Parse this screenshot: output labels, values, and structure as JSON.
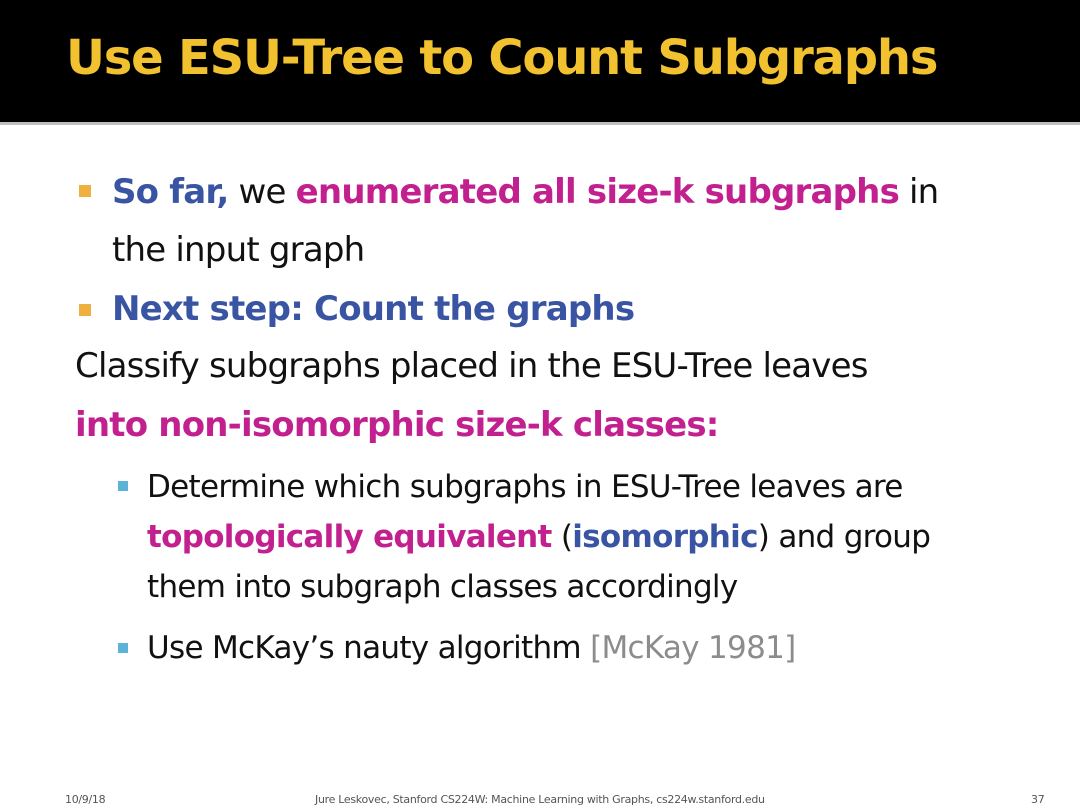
{
  "title": "Use ESU-Tree to Count Subgraphs",
  "bullets": [
    {
      "part1": "So far,",
      "part2": " we ",
      "part3": "enumerated all size-k subgraphs",
      "part4": " in",
      "line2": "the input graph"
    },
    {
      "text": "Next step: Count the graphs"
    }
  ],
  "paragraph": {
    "line1": "Classify subgraphs placed in the ESU-Tree leaves",
    "line2": "into non-isomorphic size-k classes:"
  },
  "subbullets": [
    {
      "line1": "Determine which subgraphs in ESU-Tree leaves are",
      "l2_part1": "topologically equivalent",
      "l2_part2": " (",
      "l2_part3": "isomorphic",
      "l2_part4": ") and group",
      "line3": "them into subgraph classes accordingly"
    },
    {
      "part1": "Use McKay’s nauty algorithm ",
      "part2": "[McKay 1981]"
    }
  ],
  "footer": {
    "date": "10/9/18",
    "credit": "Jure Leskovec, Stanford CS224W: Machine Learning with Graphs, cs224w.stanford.edu",
    "page": "37"
  },
  "colors": {
    "title": "#f2c130",
    "blue_emphasis": "#3a54a4",
    "magenta_emphasis": "#c21f8f",
    "bullet_level1": "#f0b040",
    "bullet_level2": "#5bb3d8",
    "citation": "#8c8c8c"
  }
}
